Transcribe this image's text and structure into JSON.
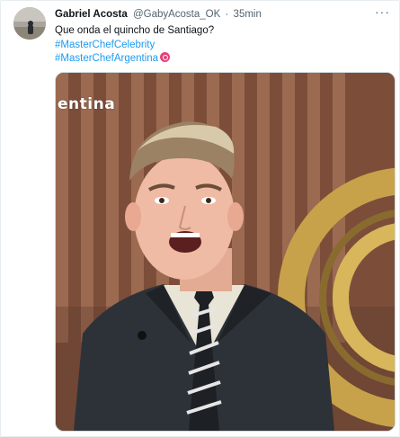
{
  "tweet": {
    "display_name": "Gabriel Acosta",
    "handle": "@GabyAcosta_OK",
    "separator": "·",
    "time": "35min",
    "text": "Que onda el  quincho de Santiago?",
    "hashtags": [
      "#MasterChefCelebrity",
      "#MasterChefArgentina"
    ],
    "more_icon": "more-dots-icon"
  },
  "media": {
    "watermark_text": "entina",
    "description_icon": "video-frame"
  },
  "colors": {
    "link": "#1d9bf0",
    "text": "#0f1419",
    "muted": "#536471",
    "badge": "#e8417a"
  }
}
